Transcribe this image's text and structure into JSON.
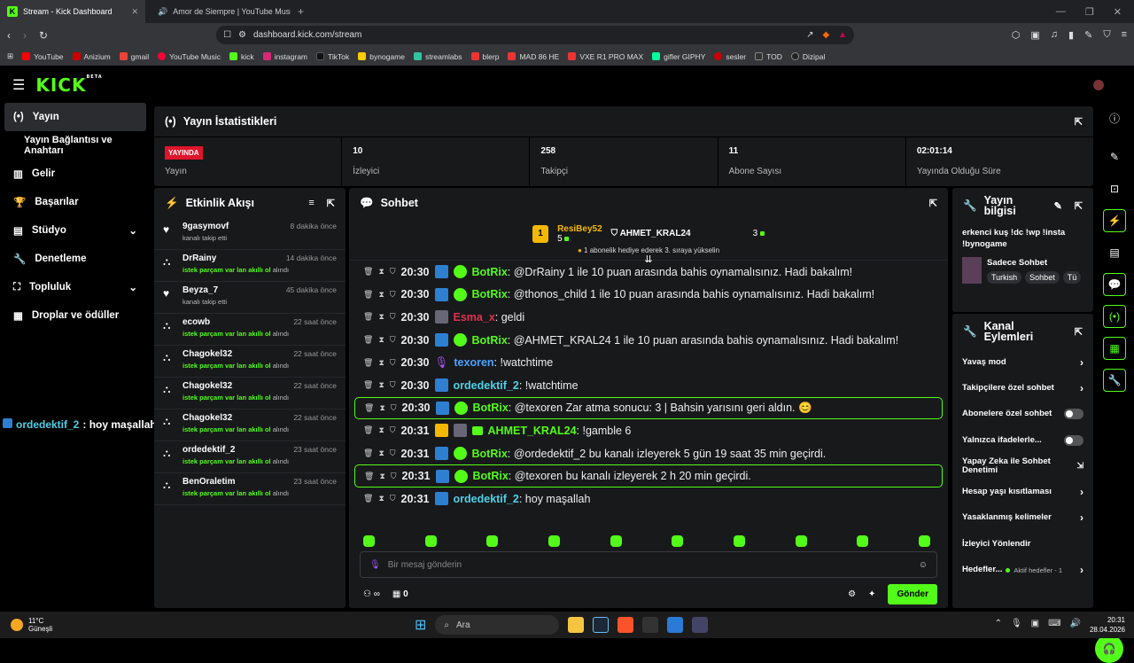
{
  "browser": {
    "tabs": [
      {
        "title": "Stream - Kick Dashboard",
        "active": true
      },
      {
        "title": "Amor de Siempre | YouTube Musi",
        "active": false
      }
    ],
    "url": "dashboard.kick.com/stream",
    "bookmarks": [
      "YouTube",
      "Anizium",
      "gmail",
      "YouTube Music",
      "kick",
      "instagram",
      "TikTok",
      "bynogame",
      "streamlabs",
      "blerp",
      "MAD 86 HE",
      "VXE R1 PRO MAX",
      "gifler GIPHY",
      "sesler",
      "TOD",
      "Dizipal"
    ]
  },
  "app": {
    "logo": "KICK",
    "logo_sup": "BETA"
  },
  "sidebar": {
    "items": [
      {
        "label": "Yayın",
        "icon": "broadcast-icon",
        "active": true
      },
      {
        "label": "Yayın Bağlantısı ve Anahtarı",
        "sub": true
      },
      {
        "label": "Gelir",
        "icon": "chart-icon"
      },
      {
        "label": "Başarılar",
        "icon": "trophy-icon"
      },
      {
        "label": "Stüdyo",
        "icon": "studio-icon",
        "chev": true
      },
      {
        "label": "Denetleme",
        "icon": "wrench-icon"
      },
      {
        "label": "Topluluk",
        "icon": "community-icon",
        "chev": true
      },
      {
        "label": "Droplar ve ödüller",
        "icon": "drops-icon"
      }
    ]
  },
  "stats": {
    "title": "Yayın İstatistikleri",
    "live_badge": "YAYINDA",
    "items": [
      {
        "value": "",
        "label": "Yayın"
      },
      {
        "value": "10",
        "label": "İzleyici"
      },
      {
        "value": "258",
        "label": "Takipçi"
      },
      {
        "value": "11",
        "label": "Abone Sayısı"
      },
      {
        "value": "02:01:14",
        "label": "Yayında Olduğu Süre"
      }
    ]
  },
  "activity": {
    "title": "Etkinlik Akışı",
    "items": [
      {
        "name": "9gasymovf",
        "time": "8 dakika önce",
        "desc": "kanalı takip etti",
        "type": "follow"
      },
      {
        "name": "DrRainy",
        "time": "14 dakika önce",
        "hl": "istek parçam var lan akıllı ol",
        "suffix": " alındı",
        "type": "redeem"
      },
      {
        "name": "Beyza_7",
        "time": "45 dakika önce",
        "desc": "kanalı takip etti",
        "type": "follow"
      },
      {
        "name": "ecowb",
        "time": "22 saat önce",
        "hl": "istek parçam var lan akıllı ol",
        "suffix": " alındı",
        "type": "redeem"
      },
      {
        "name": "Chagokel32",
        "time": "22 saat önce",
        "hl": "istek parçam var lan akıllı ol",
        "suffix": " alındı",
        "type": "redeem"
      },
      {
        "name": "Chagokel32",
        "time": "22 saat önce",
        "hl": "istek parçam var lan akıllı ol",
        "suffix": " alındı",
        "type": "redeem"
      },
      {
        "name": "Chagokel32",
        "time": "22 saat önce",
        "hl": "istek parçam var lan akıllı ol",
        "suffix": " alındı",
        "type": "redeem"
      },
      {
        "name": "ordedektif_2",
        "time": "23 saat önce",
        "hl": "istek parçam var lan akıllı ol",
        "suffix": " alındı",
        "type": "redeem"
      },
      {
        "name": "BenOraletim",
        "time": "23 saat önce",
        "hl": "istek parçam var lan akıllı ol",
        "suffix": " alındı",
        "type": "redeem"
      }
    ]
  },
  "chat": {
    "title": "Sohbet",
    "pinned": {
      "user1": "ResiBey52",
      "count1": "5",
      "user2": "AHMET_KRAL24",
      "count2": "3",
      "rank": "1",
      "sub": "1 abonelik hediye ederek 3. sıraya yükselin"
    },
    "messages": [
      {
        "time": "20:30",
        "user": "BotRix",
        "color": "#53fc18",
        "badges": [
          "mod",
          "ver"
        ],
        "text": ": @DrRainy 1 ile 10 puan arasında bahis oynamalısınız. Hadi bakalım!"
      },
      {
        "time": "20:30",
        "user": "BotRix",
        "color": "#53fc18",
        "badges": [
          "mod",
          "ver"
        ],
        "text": ": @thonos_child 1 ile 10 puan arasında bahis oynamalısınız. Hadi bakalım!"
      },
      {
        "time": "20:30",
        "user": "Esma_x",
        "color": "#e0304f",
        "badges": [
          "av"
        ],
        "text": ": geldi"
      },
      {
        "time": "20:30",
        "user": "BotRix",
        "color": "#53fc18",
        "badges": [
          "mod",
          "ver"
        ],
        "text": ": @AHMET_KRAL24 1 ile 10 puan arasında bahis oynamalısınız. Hadi bakalım!"
      },
      {
        "time": "20:30",
        "user": "texoren",
        "color": "#4aa3ff",
        "badges": [
          "mic"
        ],
        "text": ": !watchtime"
      },
      {
        "time": "20:30",
        "user": "ordedektif_2",
        "color": "#4fd1e8",
        "badges": [
          "mod"
        ],
        "text": ": !watchtime"
      },
      {
        "time": "20:30",
        "user": "BotRix",
        "color": "#53fc18",
        "badges": [
          "mod",
          "ver"
        ],
        "text": ": @texoren Zar atma sonucu: 3 | Bahsin yarısını geri aldın. 😊",
        "hl": true
      },
      {
        "time": "20:31",
        "user": "AHMET_KRAL24",
        "color": "#53fc18",
        "badges": [
          "crown",
          "av",
          "sub"
        ],
        "text": ": !gamble 6"
      },
      {
        "time": "20:31",
        "user": "BotRix",
        "color": "#53fc18",
        "badges": [
          "mod",
          "ver"
        ],
        "text": ": @ordedektif_2 bu kanalı izleyerek 5 gün 19 saat 35 min geçirdi."
      },
      {
        "time": "20:31",
        "user": "BotRix",
        "color": "#53fc18",
        "badges": [
          "mod",
          "ver"
        ],
        "text": ": @texoren bu kanalı izleyerek 2 h 20 min geçirdi.",
        "hl": true
      },
      {
        "time": "20:31",
        "user": "ordedektif_2",
        "color": "#4fd1e8",
        "badges": [
          "mod"
        ],
        "text": ": hoy maşallah"
      }
    ],
    "input_placeholder": "Bir mesaj gönderin",
    "points": "0",
    "send_label": "Gönder"
  },
  "overlay": {
    "user": "ordedektif_2",
    "text": ": hoy maşallah"
  },
  "info": {
    "title": "Yayın bilgisi",
    "stream_title": "erkenci kuş !dc !wp !insta !bynogame",
    "category": "Sadece Sohbet",
    "tags": [
      "Turkish",
      "Sohbet",
      "Tü"
    ]
  },
  "actions": {
    "title": "Kanal Eylemleri",
    "rows": [
      {
        "label": "Yavaş mod",
        "kind": "chev"
      },
      {
        "label": "Takipçilere özel sohbet",
        "kind": "chev"
      },
      {
        "label": "Abonelere özel sohbet",
        "kind": "toggle"
      },
      {
        "label": "Yalnızca ifadelerle...",
        "kind": "toggle"
      },
      {
        "label": "Yapay Zeka ile Sohbet Denetimi",
        "kind": "ext"
      },
      {
        "label": "Hesap yaşı kısıtlaması",
        "kind": "chev"
      },
      {
        "label": "Yasaklanmış kelimeler",
        "kind": "chev"
      },
      {
        "label": "İzleyici Yönlendir",
        "kind": "none"
      },
      {
        "label": "Hedefler...",
        "kind": "chev",
        "extra": "Aktif hedefler - 1"
      }
    ]
  },
  "taskbar": {
    "temp": "11°C",
    "weather": "Güneşli",
    "search": "Ara",
    "time": "20:31",
    "date": "28.04.2026"
  },
  "colors": {
    "accent": "#53fc18",
    "panel": "#18191b",
    "live": "#e0152b"
  }
}
